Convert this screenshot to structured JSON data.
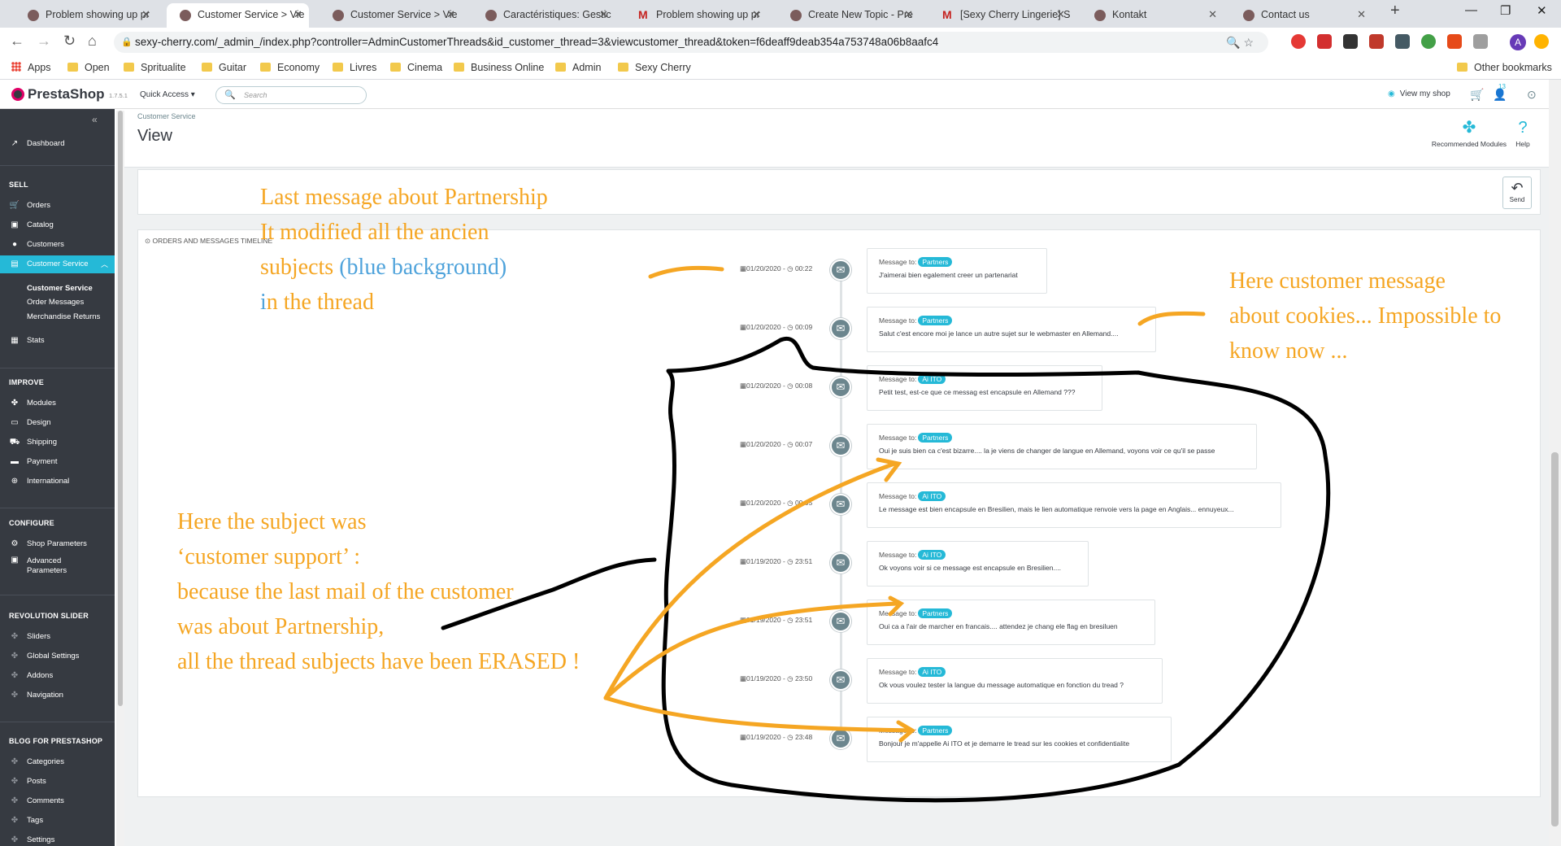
{
  "browser": {
    "tabs": [
      {
        "title": "Problem showing up pr",
        "favicon": "prestashop-icon"
      },
      {
        "title": "Customer Service > Vie",
        "favicon": "prestashop-icon"
      },
      {
        "title": "Customer Service > Vie",
        "favicon": "prestashop-icon"
      },
      {
        "title": "Caractéristiques: Gestic",
        "favicon": "prestashop-icon"
      },
      {
        "title": "Problem showing up pr",
        "favicon": "gmail-icon"
      },
      {
        "title": "Create New Topic - Pre",
        "favicon": "prestashop-icon"
      },
      {
        "title": "[Sexy Cherry Lingerie] S",
        "favicon": "gmail-icon"
      },
      {
        "title": "Kontakt",
        "favicon": "prestashop-icon"
      },
      {
        "title": "Contact us",
        "favicon": "prestashop-icon"
      }
    ],
    "active_tab": 1,
    "url": "sexy-cherry.com/_admin_/index.php?controller=AdminCustomerThreads&id_customer_thread=3&viewcustomer_thread&token=f6deaff9deab354a753748a06b8aafc4",
    "profile_initial": "A",
    "bookmarks": [
      "Apps",
      "Open",
      "Spritualite",
      "Guitar",
      "Economy",
      "Livres",
      "Cinema",
      "Business Online",
      "Admin",
      "Sexy Cherry"
    ],
    "other_bookmarks": "Other bookmarks"
  },
  "ps": {
    "logo": "PrestaShop",
    "version": "1.7.5.1",
    "quick_access": "Quick Access ▾",
    "search_placeholder": "Search",
    "view_shop": "View my shop",
    "notif_count": "13"
  },
  "sidebar": {
    "dashboard": "Dashboard",
    "sell": "SELL",
    "orders": "Orders",
    "catalog": "Catalog",
    "customers": "Customers",
    "customer_service": "Customer Service",
    "sub_customer_service": "Customer Service",
    "sub_order_messages": "Order Messages",
    "sub_merchandise_returns": "Merchandise Returns",
    "stats": "Stats",
    "improve": "IMPROVE",
    "modules": "Modules",
    "design": "Design",
    "shipping": "Shipping",
    "payment": "Payment",
    "international": "International",
    "configure": "CONFIGURE",
    "shop_parameters": "Shop Parameters",
    "advanced_parameters_1": "Advanced",
    "advanced_parameters_2": "Parameters",
    "revolution_slider": "REVOLUTION SLIDER",
    "sliders": "Sliders",
    "global_settings": "Global Settings",
    "addons": "Addons",
    "navigation": "Navigation",
    "blog": "BLOG FOR PRESTASHOP",
    "categories": "Categories",
    "posts": "Posts",
    "comments": "Comments",
    "tags": "Tags",
    "settings": "Settings"
  },
  "page": {
    "breadcrumb": "Customer Service",
    "title": "View",
    "recommended_modules": "Recommended Modules",
    "help": "Help",
    "send": "Send",
    "timeline_title": "Orders and messages timeline"
  },
  "timeline": [
    {
      "date": "01/20/2020",
      "time": "00:22",
      "to_label": "Message to:",
      "to": "Partners",
      "message": "J'aimerai bien egalement creer un partenariat"
    },
    {
      "date": "01/20/2020",
      "time": "00:09",
      "to_label": "Message to:",
      "to": "Partners",
      "message": "Salut c'est encore moi je lance un autre sujet sur le webmaster en Allemand...."
    },
    {
      "date": "01/20/2020",
      "time": "00:08",
      "to_label": "Message to:",
      "to": "Ai ITO",
      "message": "Petit test, est-ce que ce messag est encapsule en Allemand ???"
    },
    {
      "date": "01/20/2020",
      "time": "00:07",
      "to_label": "Message to:",
      "to": "Partners",
      "message": "Oui je suis bien ca c'est bizarre.... la je viens de changer de langue en Allemand, voyons voir ce qu'il se passe"
    },
    {
      "date": "01/20/2020",
      "time": "00:05",
      "to_label": "Message to:",
      "to": "Ai ITO",
      "message": "Le message est bien encapsule en Bresilien, mais le lien automatique renvoie vers la page en Anglais... ennuyeux..."
    },
    {
      "date": "01/19/2020",
      "time": "23:51",
      "to_label": "Message to:",
      "to": "Ai ITO",
      "message": "Ok voyons voir si ce message est encapsule en Bresilien...."
    },
    {
      "date": "01/19/2020",
      "time": "23:51",
      "to_label": "Message to:",
      "to": "Partners",
      "message": "Oui ca a l'air de marcher en francais.... attendez je chang ele flag en bresiluen"
    },
    {
      "date": "01/19/2020",
      "time": "23:50",
      "to_label": "Message to:",
      "to": "Ai ITO",
      "message": "Ok vous voulez tester la langue du message automatique en fonction du tread ?"
    },
    {
      "date": "01/19/2020",
      "time": "23:48",
      "to_label": "Message to:",
      "to": "Partners",
      "message": "Bonjour je m'appelle Ai ITO et je demarre le tread sur les cookies et confidentialite"
    }
  ],
  "annotations": {
    "top_left": [
      "Last message about Partnership",
      "It modified all the ancien",
      "subjects ",
      "(blue background)",
      "i",
      "n the thread"
    ],
    "top_right": [
      "Here customer message",
      "about cookies... Impossible to",
      "know now ..."
    ],
    "bottom_left": [
      "Here the subject was",
      "‘customer support’ :",
      "because the last mail of the customer",
      "was about Partnership,",
      "all the thread subjects have been ERASED !"
    ],
    "colors": {
      "orange": "#f5a623",
      "blue": "#4fa3db",
      "ink": "#000000"
    }
  }
}
